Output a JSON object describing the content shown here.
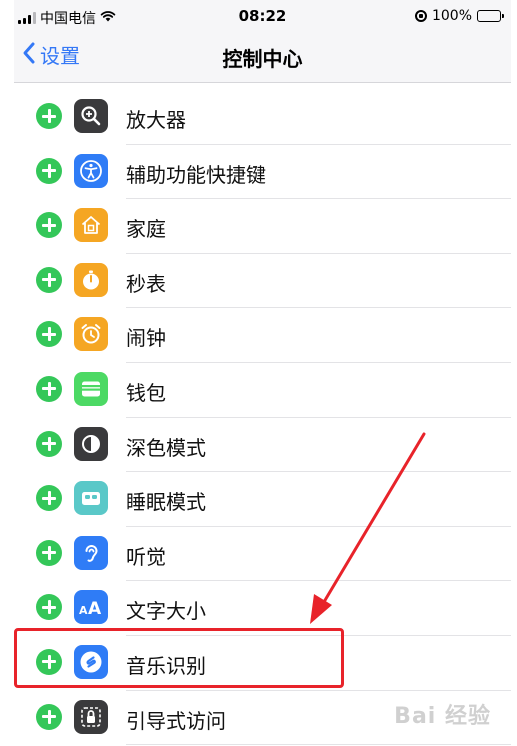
{
  "status": {
    "carrier": "中国电信",
    "time": "08:22",
    "battery": "100%",
    "battery_level": 1.0
  },
  "nav": {
    "back_label": "设置",
    "title": "控制中心"
  },
  "colors": {
    "accent": "#3478f6",
    "add_green": "#34c759",
    "highlight_red": "#e8232a"
  },
  "controls": [
    {
      "label": "放大器",
      "icon": "magnifier-icon",
      "color": "#3a3a3c"
    },
    {
      "label": "辅助功能快捷键",
      "icon": "accessibility-icon",
      "color": "#2f7cf6"
    },
    {
      "label": "家庭",
      "icon": "home-icon",
      "color": "#f5a623"
    },
    {
      "label": "秒表",
      "icon": "stopwatch-icon",
      "color": "#f5a623"
    },
    {
      "label": "闹钟",
      "icon": "alarm-icon",
      "color": "#f5a623"
    },
    {
      "label": "钱包",
      "icon": "wallet-icon",
      "color": "#4cd964"
    },
    {
      "label": "深色模式",
      "icon": "dark-mode-icon",
      "color": "#3a3a3c"
    },
    {
      "label": "睡眠模式",
      "icon": "sleep-icon",
      "color": "#5ac8c8"
    },
    {
      "label": "听觉",
      "icon": "hearing-icon",
      "color": "#2f7cf6"
    },
    {
      "label": "文字大小",
      "icon": "text-size-icon",
      "color": "#2f7cf6"
    },
    {
      "label": "音乐识别",
      "icon": "shazam-icon",
      "color": "#2f7cf6"
    },
    {
      "label": "引导式访问",
      "icon": "guided-access-icon",
      "color": "#3a3a3c"
    }
  ],
  "watermark": "Bai 经验"
}
